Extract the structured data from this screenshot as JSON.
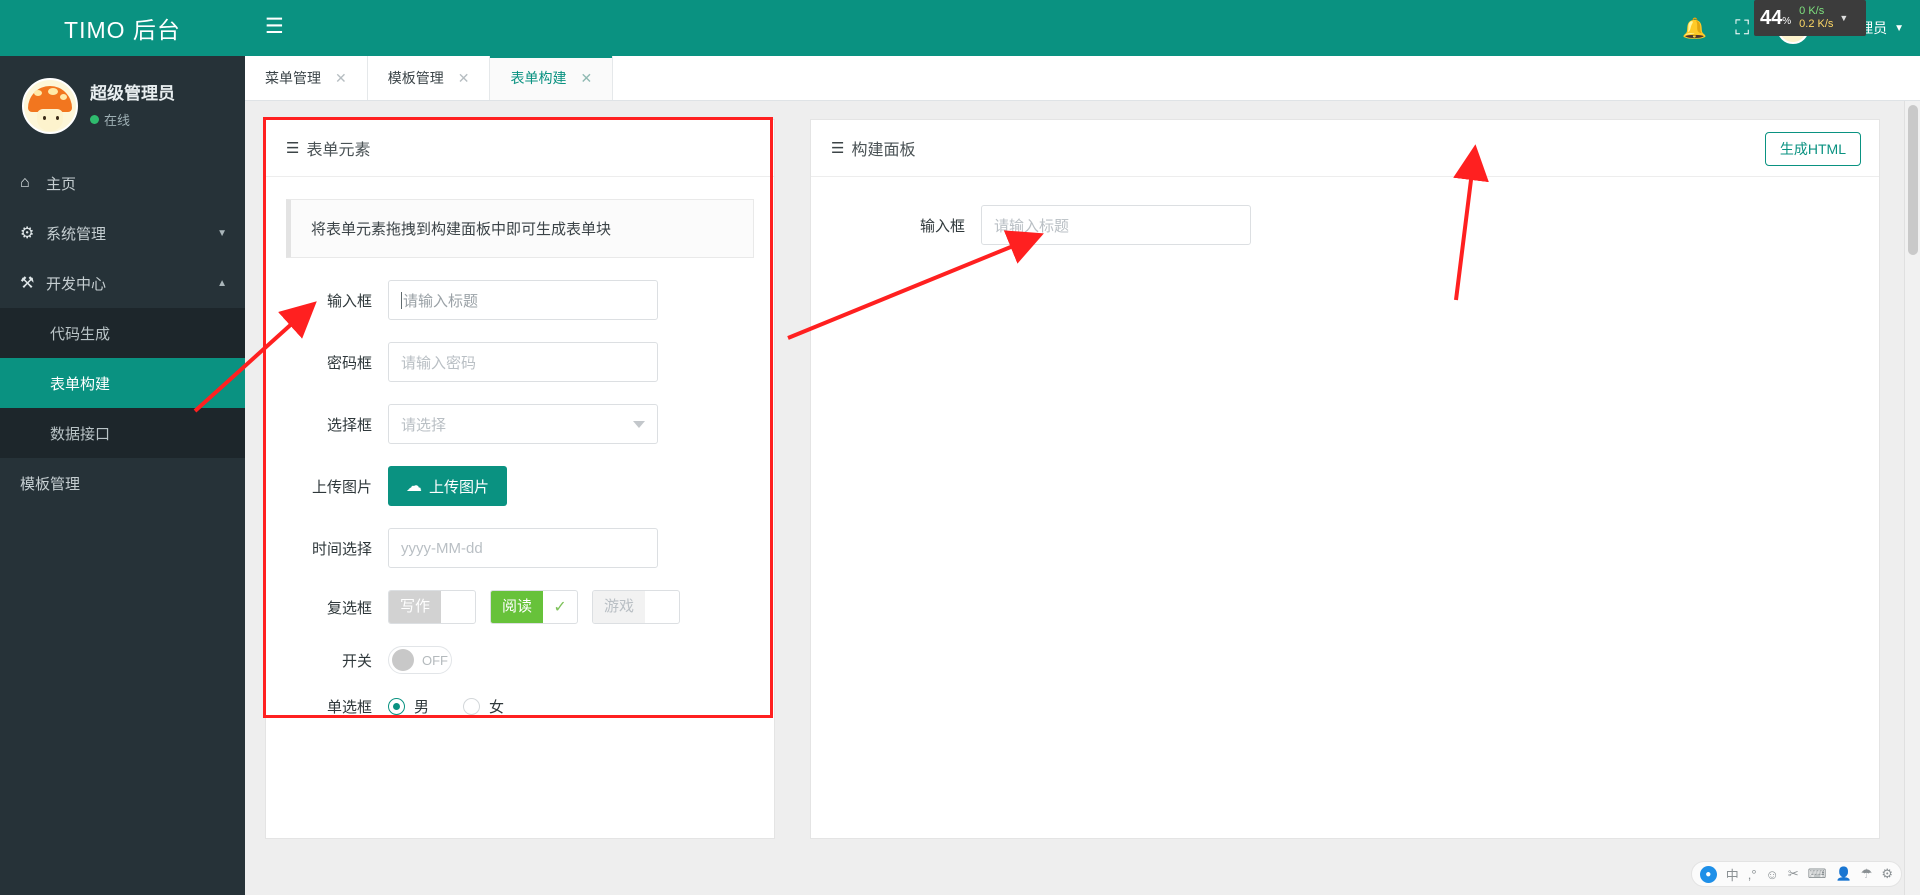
{
  "brand": {
    "title": "TIMO 后台"
  },
  "user": {
    "name": "超级管理员",
    "status": "在线"
  },
  "sidebar": {
    "items": [
      {
        "label": "主页",
        "icon": "home-icon",
        "glyph": "⌂"
      },
      {
        "label": "系统管理",
        "icon": "gear-icon",
        "glyph": "⚙"
      },
      {
        "label": "开发中心",
        "icon": "hammer-icon",
        "glyph": "⚒"
      }
    ],
    "submenu": [
      {
        "label": "代码生成",
        "active": false
      },
      {
        "label": "表单构建",
        "active": true
      },
      {
        "label": "数据接口",
        "active": false
      }
    ],
    "footer_item": {
      "label": "模板管理"
    }
  },
  "topbar": {
    "menu_icon": "hamburger-icon",
    "bell_icon": "bell-icon",
    "fullscreen_icon": "fullscreen-icon",
    "user_name": "超级管理员",
    "netspeed": {
      "percent": "44",
      "percent_unit": "%",
      "up": "0 K/s",
      "down": "0.2 K/s"
    }
  },
  "tabs": [
    {
      "label": "菜单管理",
      "active": false
    },
    {
      "label": "模板管理",
      "active": false
    },
    {
      "label": "表单构建",
      "active": true
    }
  ],
  "left_panel": {
    "title": "表单元素",
    "hint": "将表单元素拖拽到构建面板中即可生成表单块",
    "rows": [
      {
        "label": "输入框",
        "type": "input",
        "placeholder": "请输入标题"
      },
      {
        "label": "密码框",
        "type": "input",
        "placeholder": "请输入密码"
      },
      {
        "label": "选择框",
        "type": "select",
        "placeholder": "请选择"
      },
      {
        "label": "上传图片",
        "type": "upload",
        "button_label": "上传图片"
      },
      {
        "label": "时间选择",
        "type": "input",
        "placeholder": "yyyy-MM-dd"
      },
      {
        "label": "复选框",
        "type": "checkbox"
      },
      {
        "label": "开关",
        "type": "switch",
        "state": "OFF"
      },
      {
        "label": "单选框",
        "type": "radio"
      }
    ],
    "checkbox_options": [
      {
        "label": "写作",
        "state": "off"
      },
      {
        "label": "阅读",
        "state": "on"
      },
      {
        "label": "游戏",
        "state": "plain"
      }
    ],
    "radio_options": [
      {
        "label": "男",
        "selected": true
      },
      {
        "label": "女",
        "selected": false
      }
    ]
  },
  "right_panel": {
    "title": "构建面板",
    "generate_button": "生成HTML",
    "rows": [
      {
        "label": "输入框",
        "placeholder": "请输入标题"
      }
    ]
  },
  "ime": {
    "lang": "中",
    "items": [
      "logo-icon",
      "lang-icon",
      "punct-icon",
      "emoji-icon",
      "scissors-icon",
      "keyboard-icon",
      "user-icon",
      "umbrella-icon",
      "gear-icon"
    ]
  },
  "colors": {
    "brand": "#0a9281",
    "sidebar": "#263238",
    "submenu": "#1d262b",
    "annotation": "#ff2020",
    "checkbox_on": "#67c23a"
  }
}
